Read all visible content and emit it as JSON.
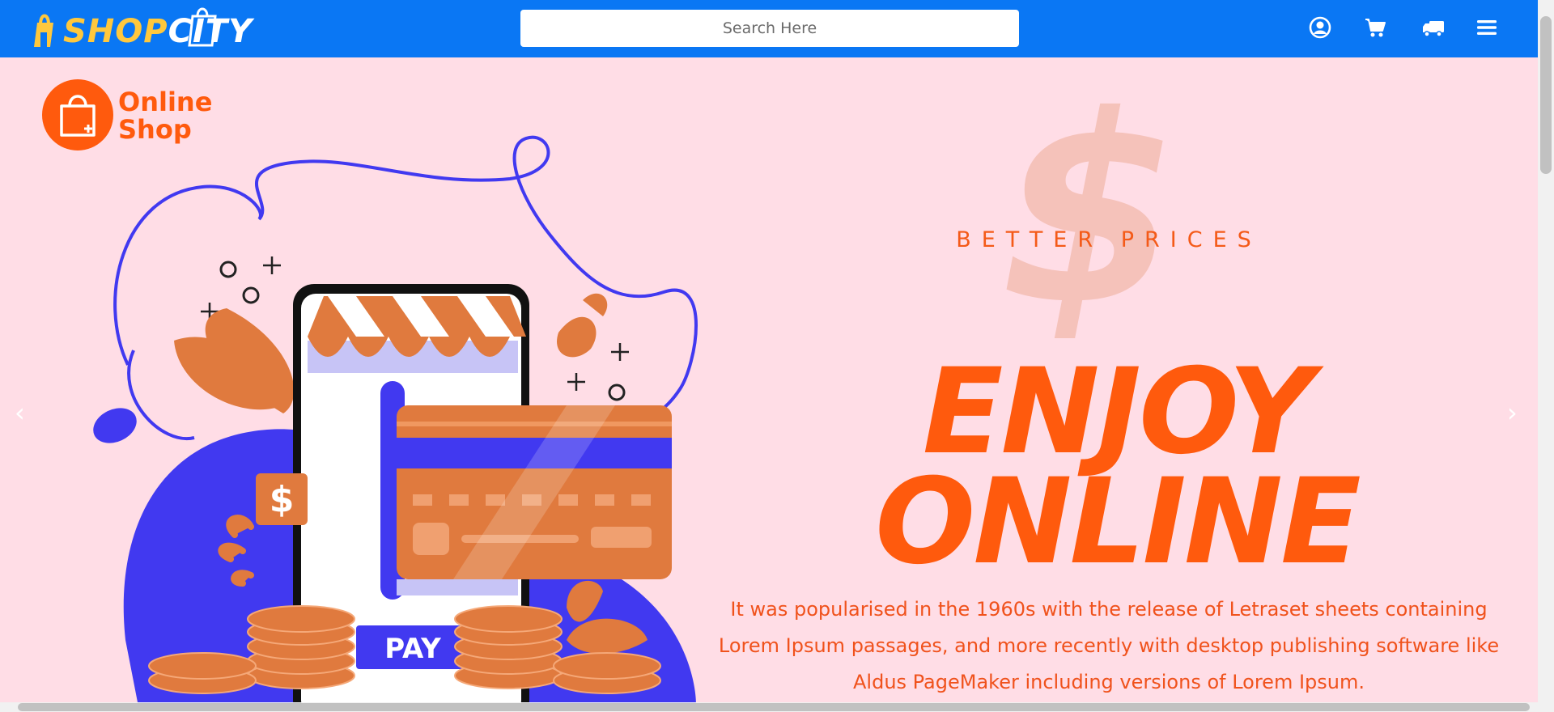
{
  "nav": {
    "logo_shop": "SHOP",
    "logo_city": "CITY",
    "search_placeholder": "Search Here",
    "icons": [
      "user-circle-icon",
      "cart-icon",
      "truck-icon",
      "menu-icon"
    ]
  },
  "hero": {
    "brand_line1": "Online",
    "brand_line2": "Shop",
    "pay_label": "PAY",
    "dollar_badge": "$",
    "big_dollar": "$",
    "subtitle": "BETTER PRICES",
    "headline_line1": "ENJOY",
    "headline_line2": "ONLINE",
    "description": "It was popularised in the 1960s with the release of Letraset sheets containing Lorem Ipsum passages, and more recently with desktop publishing software like Aldus PageMaker including versions of Lorem Ipsum."
  },
  "carousel": {
    "prev": "‹",
    "next": "›"
  },
  "colors": {
    "nav_bg": "#0a77f4",
    "hero_bg": "#ffdde6",
    "accent": "#ff5a0d",
    "blue": "#4139f0",
    "orange": "#e07a3e"
  }
}
